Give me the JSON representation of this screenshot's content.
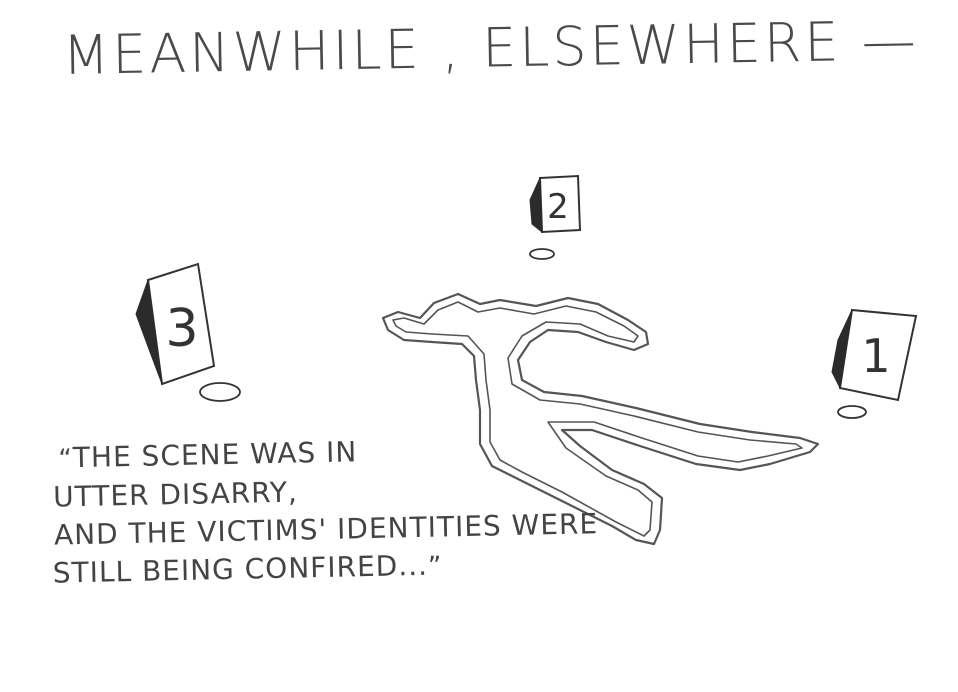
{
  "title": "MEANWHILE , ELSEWHERE —",
  "caption": {
    "open_quote": "“",
    "lines": [
      "THE SCENE WAS IN",
      "UTTER DISARRY,",
      "AND THE VICTIMS' IDENTITIES WERE",
      "STILL BEING CONFIRED..."
    ],
    "close_quote": "”"
  },
  "markers": [
    {
      "label": "1"
    },
    {
      "label": "2"
    },
    {
      "label": "3"
    }
  ],
  "colors": {
    "pencil": "#444444",
    "background": "#ffffff"
  }
}
